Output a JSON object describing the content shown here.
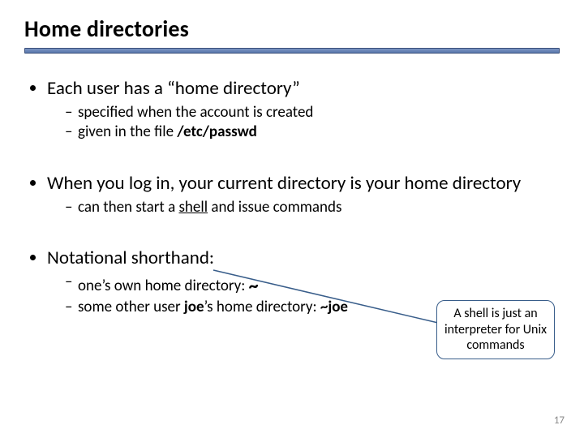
{
  "title": "Home directories",
  "bullets": {
    "b1": "Each user has a “home directory”",
    "b1s1": "specified when the account is created",
    "b1s2_pre": "given in the file ",
    "b1s2_path": "/etc/passwd",
    "b2": "When you log in, your current directory is your home directory",
    "b2s1_pre": "can then start a ",
    "b2s1_u": "shell",
    "b2s1_post": " and issue commands",
    "b3": "Notational shorthand:",
    "b3s1_pre": "one’s own home directory:   ",
    "b3s1_sym": "~",
    "b3s2_pre": "some other user ",
    "b3s2_user": "joe",
    "b3s2_mid": "’s home directory: ",
    "b3s2_sym": "~joe"
  },
  "callout": "A shell is just an interpreter for Unix commands",
  "page_number": "17"
}
